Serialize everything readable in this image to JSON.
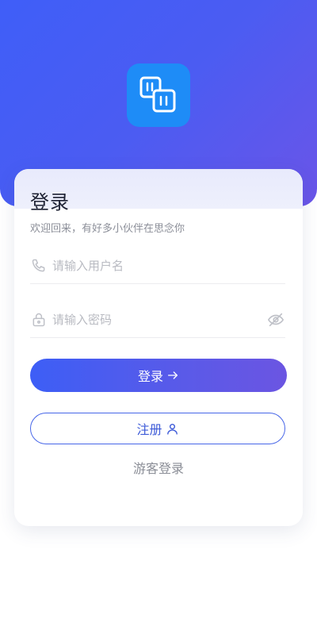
{
  "login": {
    "title": "登录",
    "subtitle": "欢迎回来，有好多小伙伴在思念你",
    "username_placeholder": "请输入用户名",
    "password_placeholder": "请输入密码",
    "login_button": "登录",
    "register_button": "注册",
    "guest_login": "游客登录"
  },
  "icons": {
    "logo": "app-logo-icon",
    "phone": "phone-icon",
    "lock": "lock-icon",
    "eye_off": "eye-off-icon",
    "arrow": "arrow-right-icon",
    "user": "user-icon"
  },
  "colors": {
    "hero_gradient_start": "#3f5ef8",
    "hero_gradient_end": "#6a55e8",
    "logo_bg": "#1e8cf7",
    "primary_text": "#3e5bd8"
  }
}
